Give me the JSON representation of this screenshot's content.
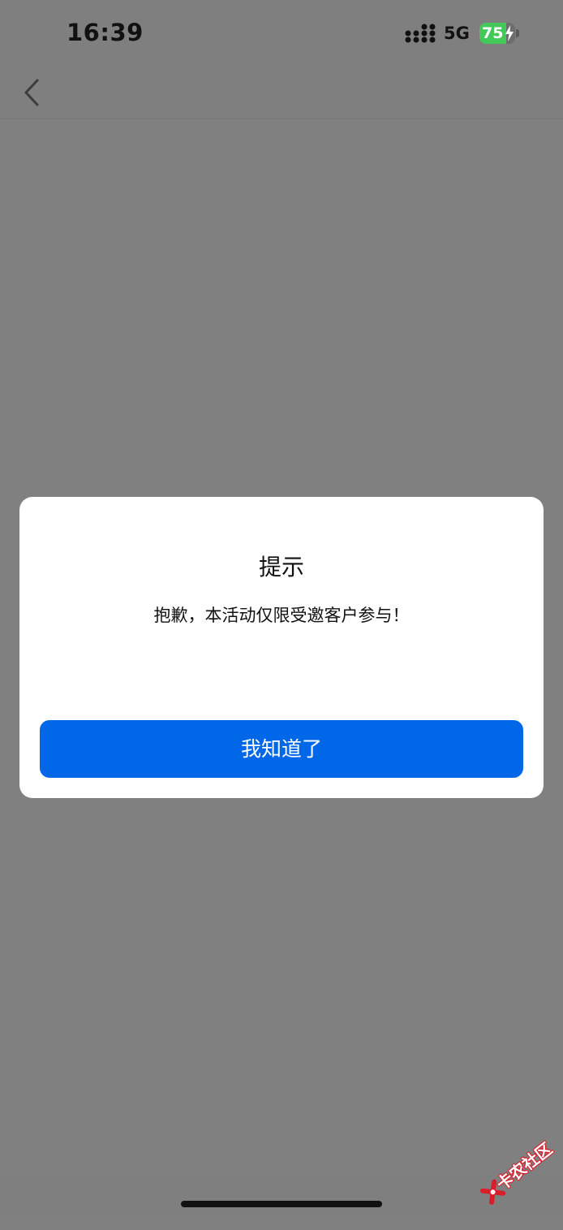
{
  "status_bar": {
    "time": "16:39",
    "network": "5G",
    "battery_level": "75",
    "battery_percent": 75,
    "signal_icon": "signal-dots-icon",
    "charging_icon": "bolt-icon"
  },
  "nav_bar": {
    "back_icon": "chevron-left-icon"
  },
  "dialog": {
    "title": "提示",
    "message": "抱歉，本活动仅限受邀客户参与！",
    "confirm_label": "我知道了"
  },
  "watermark": {
    "text": "卡农社区"
  },
  "colors": {
    "overlay": "#808080",
    "dialog_background": "#ffffff",
    "button": "#0068e8",
    "battery": "#43c95a",
    "watermark": "#d81e2b"
  }
}
